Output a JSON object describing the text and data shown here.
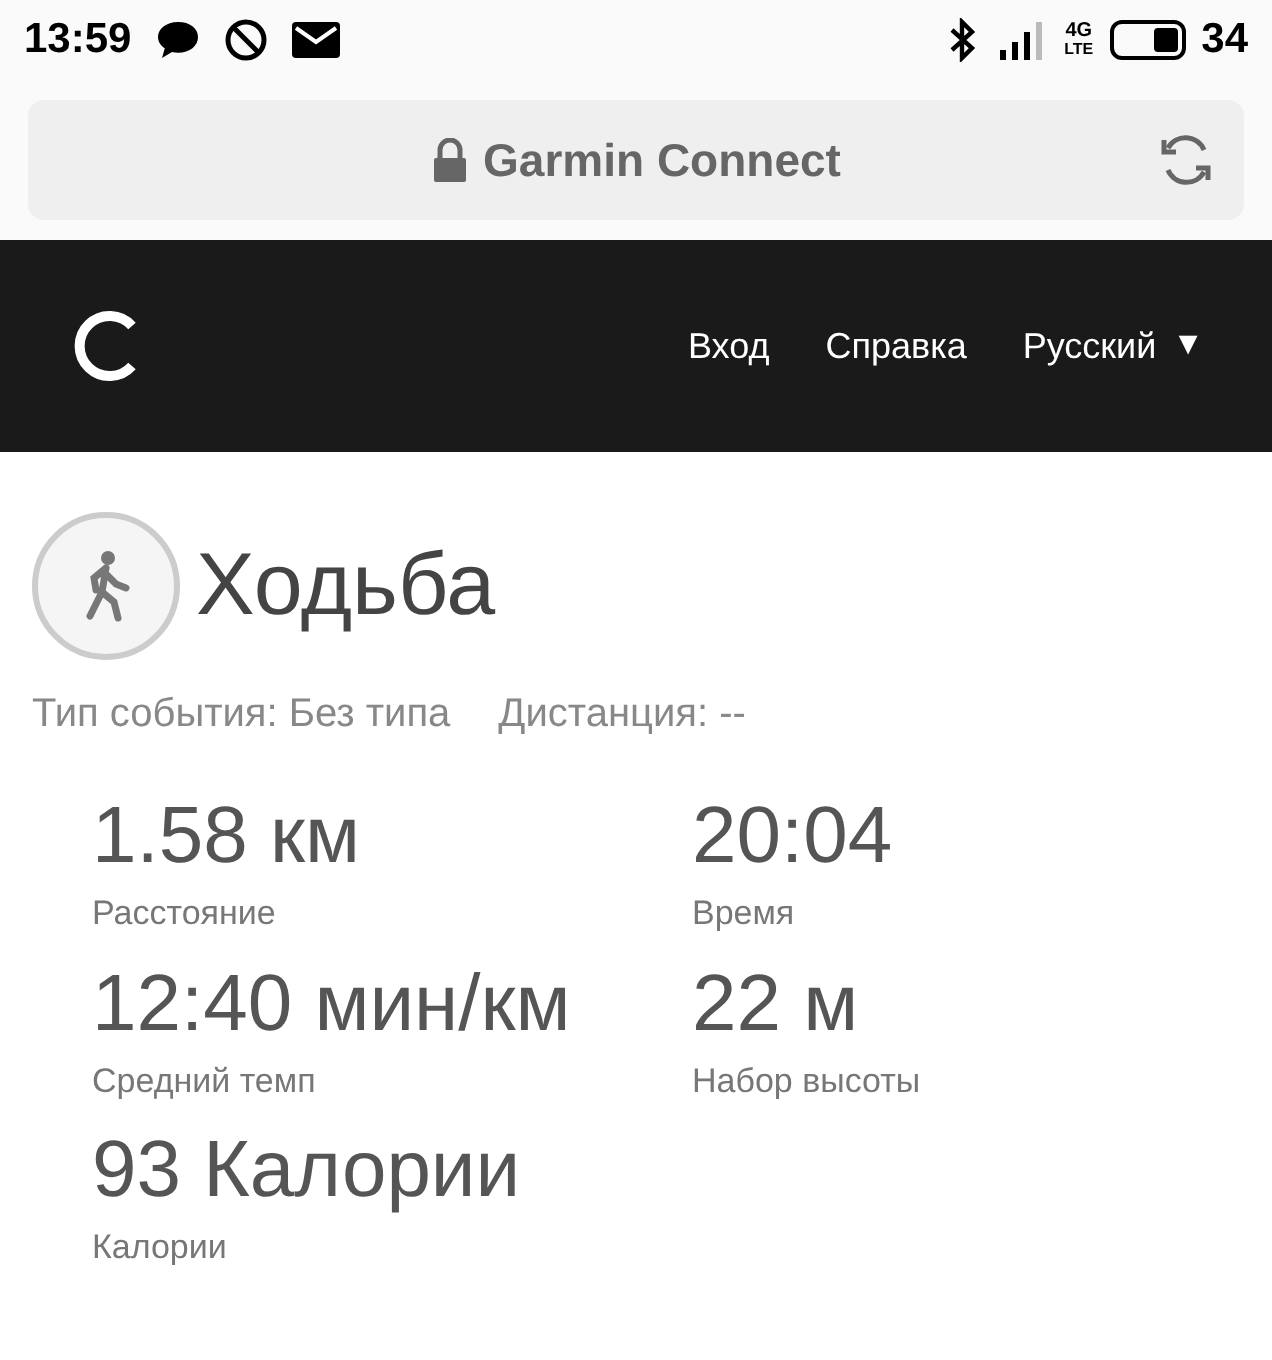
{
  "status_bar": {
    "time": "13:59",
    "network_top": "4G",
    "network_bottom": "LTE",
    "battery": "34"
  },
  "address_bar": {
    "title": "Garmin Connect"
  },
  "nav": {
    "links": [
      "Вход",
      "Справка"
    ],
    "language": "Русский",
    "caret": "▼"
  },
  "activity": {
    "title": "Ходьба",
    "event_type": "Тип события: Без типа",
    "distance": "Дистанция: --"
  },
  "stats": [
    {
      "value": "1.58 км",
      "label": "Расстояние"
    },
    {
      "value": "20:04",
      "label": "Время"
    },
    {
      "value": "12:40 мин/км",
      "label": "Средний темп"
    },
    {
      "value": "22 м",
      "label": "Набор высоты"
    },
    {
      "value": "93 Калории",
      "label": "Калории"
    }
  ]
}
